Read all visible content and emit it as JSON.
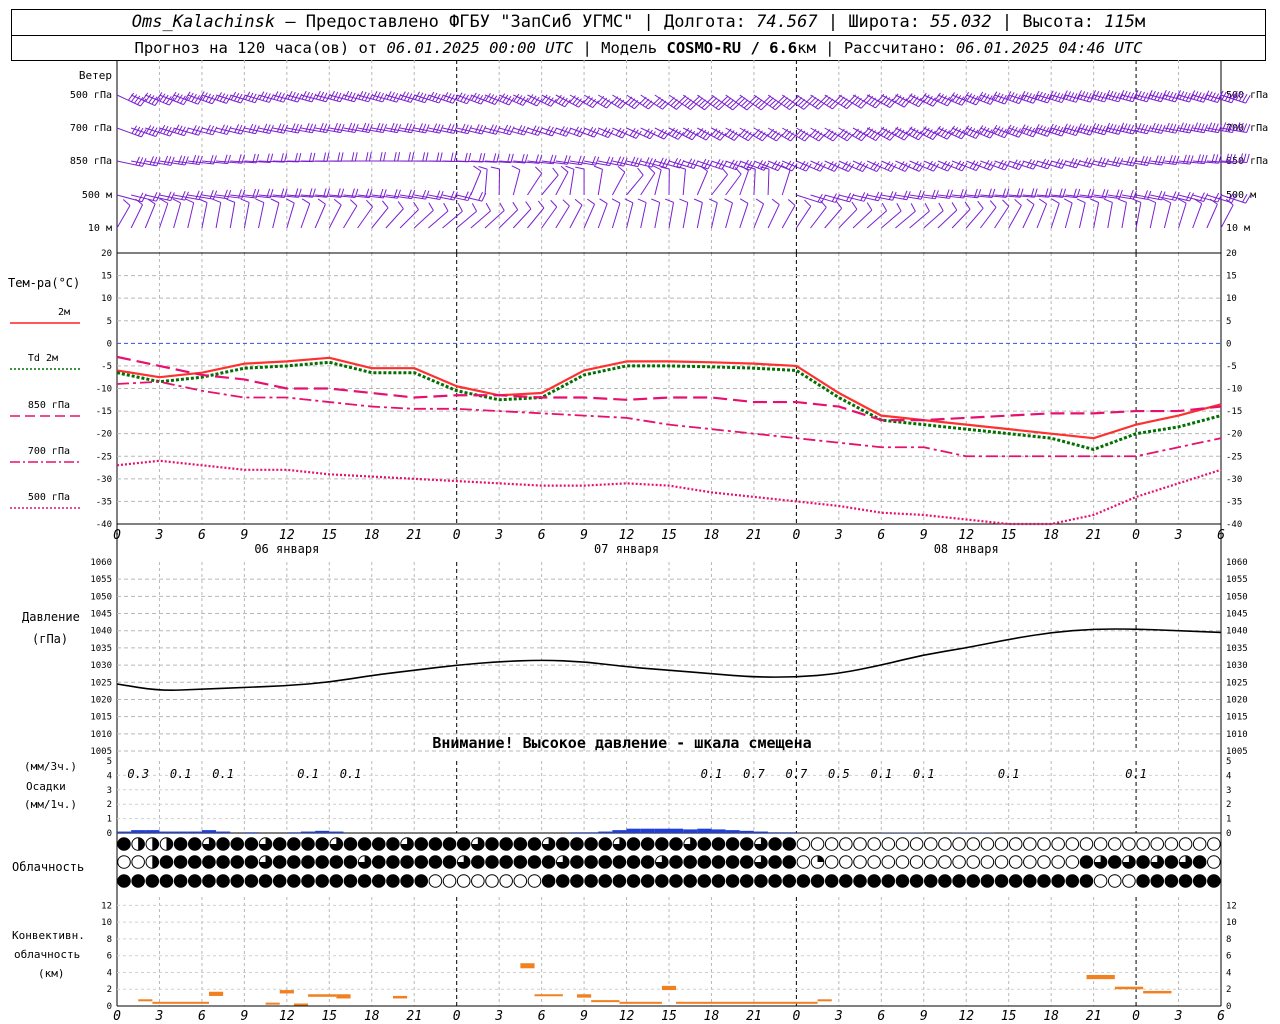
{
  "header": {
    "station": "Oms_Kalachinsk",
    "provider": "— Предоставлено ФГБУ \"ЗапСиб УГМС\" |",
    "lon_label": "Долгота:",
    "lon": "74.567",
    "lat_label": "| Широта:",
    "lat": "55.032",
    "alt_label": "| Высота:",
    "alt": "115",
    "alt_unit": "м",
    "forecast_label": "Прогноз на 120 часа(ов) от",
    "forecast_from": "06.01.2025 00:00 UTC",
    "model_label": "| Модель",
    "model": "COSMO-RU / 6.6",
    "model_unit": "км",
    "calc_label": "| Рассчитано:",
    "calc_time": "06.01.2025 04:46 UTC"
  },
  "wind": {
    "title": "Ветер",
    "levels": [
      "500 гПа",
      "700 гПа",
      "850 гПа",
      "500 м",
      "10 м"
    ],
    "color": "#7b1fd0"
  },
  "temp_panel": {
    "title": "Тем-ра(°С)",
    "legend": [
      {
        "label": "2м",
        "color": "#ff2020",
        "dash": "solid"
      },
      {
        "label": "Td 2м",
        "color": "#007000",
        "dash": "dot"
      },
      {
        "label": "850 гПа",
        "color": "#e8106e",
        "dash": "dash"
      },
      {
        "label": "700 гПа",
        "color": "#e8106e",
        "dash": "dashdot"
      },
      {
        "label": "500 гПа",
        "color": "#e8106e",
        "dash": "dot"
      }
    ]
  },
  "pressure_panel": {
    "title": "Давление",
    "unit": "(гПа)",
    "warning": "Внимание! Высокое давление - шкала смещена"
  },
  "precip_panel": {
    "unit_top": "(мм/3ч.)",
    "title": "Осадки",
    "unit_bottom": "(мм/1ч.)",
    "labels": [
      {
        "h": 3,
        "t": "0.3"
      },
      {
        "h": 9,
        "t": "0.1"
      },
      {
        "h": 15,
        "t": "0.1"
      },
      {
        "h": 27,
        "t": "0.1"
      },
      {
        "h": 33,
        "t": "0.1"
      },
      {
        "h": 84,
        "t": "0.1"
      },
      {
        "h": 90,
        "t": "0.7"
      },
      {
        "h": 96,
        "t": "0.7"
      },
      {
        "h": 102,
        "t": "0.5"
      },
      {
        "h": 108,
        "t": "0.1"
      },
      {
        "h": 114,
        "t": "0.1"
      },
      {
        "h": 126,
        "t": "0.1"
      },
      {
        "h": 144,
        "t": "0.1"
      }
    ],
    "color": "#1f3fd8"
  },
  "cloud_panel": {
    "title": "Облачность"
  },
  "conv_panel": {
    "title1": "Конвективн.",
    "title2": "облачность",
    "unit": "(км)",
    "color": "#f08020"
  },
  "time_axis": {
    "tick_labels": [
      "0",
      "3",
      "6",
      "9",
      "12",
      "15",
      "18",
      "21",
      "0",
      "3",
      "6",
      "9",
      "12",
      "15",
      "18",
      "21",
      "0",
      "3",
      "6",
      "9",
      "12",
      "15",
      "18",
      "21",
      "0",
      "3",
      "6"
    ],
    "days": [
      {
        "h": 12,
        "t": "06 января"
      },
      {
        "h": 36,
        "t": "07 января"
      },
      {
        "h": 60,
        "t": "08 января"
      }
    ]
  },
  "chart_data": [
    {
      "type": "line",
      "title": "",
      "xlabel": "",
      "ylabel": "Тем-ра(°С)",
      "ylim": [
        -40,
        20
      ],
      "x_hours": [
        0,
        3,
        6,
        9,
        12,
        15,
        18,
        21,
        24,
        27,
        30,
        33,
        36,
        39,
        42,
        45,
        48,
        51,
        54,
        57,
        60,
        63,
        66,
        69,
        72,
        75,
        78
      ],
      "series": [
        {
          "name": "2м",
          "values": [
            -6,
            -7.5,
            -6.5,
            -4.5,
            -4,
            -3.2,
            -5.5,
            -5.5,
            -9.5,
            -11.5,
            -11,
            -6,
            -4,
            -4,
            -4.2,
            -4.5,
            -5,
            -11,
            -16,
            -17,
            -18,
            -19,
            -20,
            -21,
            -18,
            -16,
            -13.5
          ]
        },
        {
          "name": "Td 2м",
          "values": [
            -6.5,
            -8.5,
            -7.5,
            -5.5,
            -5,
            -4.2,
            -6.5,
            -6.5,
            -10.5,
            -12.5,
            -12,
            -7,
            -5,
            -5,
            -5.2,
            -5.5,
            -6,
            -12,
            -17,
            -18,
            -19,
            -20,
            -21,
            -23.5,
            -20,
            -18.5,
            -16
          ]
        },
        {
          "name": "850 гПа",
          "values": [
            -3,
            -5,
            -7,
            -8,
            -10,
            -10,
            -11,
            -12,
            -11.5,
            -11.5,
            -12,
            -12,
            -12.5,
            -12,
            -12,
            -13,
            -13,
            -14,
            -17,
            -17,
            -16.5,
            -16,
            -15.5,
            -15.5,
            -15,
            -15,
            -14
          ]
        },
        {
          "name": "700 гПа",
          "values": [
            -9,
            -8.5,
            -10.5,
            -12,
            -12,
            -13,
            -14,
            -14.5,
            -14.5,
            -15,
            -15.5,
            -16,
            -16.5,
            -18,
            -19,
            -20,
            -21,
            -22,
            -23,
            -23,
            -25,
            -25,
            -25,
            -25,
            -25,
            -23,
            -21
          ]
        },
        {
          "name": "500 гПа",
          "values": [
            -27,
            -26,
            -27,
            -28,
            -28,
            -29,
            -29.5,
            -30,
            -30.5,
            -31,
            -31.5,
            -31.5,
            -31,
            -31.5,
            -33,
            -34,
            -35,
            -36,
            -37.5,
            -38,
            -39,
            -41,
            -43,
            -38,
            -34,
            -31,
            -28
          ]
        }
      ]
    },
    {
      "type": "line",
      "title": "",
      "xlabel": "",
      "ylabel": "Давление (гПа)",
      "ylim": [
        1005,
        1060
      ],
      "x_hours": [
        0,
        3,
        6,
        9,
        12,
        15,
        18,
        21,
        24,
        27,
        30,
        33,
        36,
        39,
        42,
        45,
        48,
        51,
        54,
        57,
        60,
        63,
        66,
        69,
        72,
        75,
        78
      ],
      "series": [
        {
          "name": "",
          "values": [
            1024.5,
            1022.5,
            1023,
            1023.5,
            1024,
            1025,
            1027,
            1028.5,
            1030,
            1031,
            1031.5,
            1031,
            1029.5,
            1028.5,
            1027.5,
            1026.5,
            1026.5,
            1027.5,
            1030,
            1033,
            1035,
            1037.5,
            1039.5,
            1040.5,
            1040.5,
            1040,
            1039.5
          ]
        }
      ]
    },
    {
      "type": "bar",
      "title": "",
      "xlabel": "",
      "ylabel": "Осадки (мм/1ч.)",
      "ylim": [
        0,
        5
      ],
      "x_hours": [
        0,
        1,
        2,
        3,
        4,
        5,
        6,
        7,
        8,
        9,
        10,
        11,
        12,
        13,
        14,
        15,
        16,
        17,
        18,
        19,
        20,
        21,
        22,
        23,
        24,
        25,
        26,
        27,
        28,
        29,
        30,
        31,
        32,
        33,
        34,
        35,
        36,
        37,
        38,
        39,
        40,
        41,
        42,
        43,
        44,
        45,
        46,
        47,
        48,
        49,
        50,
        51,
        52,
        53,
        54,
        55,
        56,
        57,
        58,
        59,
        60,
        61,
        62,
        63,
        64,
        65,
        66,
        67,
        68,
        69,
        70,
        71,
        72,
        73,
        74,
        75,
        76,
        77
      ],
      "values": [
        0.1,
        0.2,
        0.2,
        0.1,
        0.1,
        0.1,
        0.2,
        0.1,
        0,
        0.05,
        0,
        0,
        0.05,
        0.1,
        0.15,
        0.1,
        0,
        0,
        0,
        0,
        0,
        0,
        0,
        0,
        0,
        0,
        0,
        0,
        0,
        0,
        0,
        0,
        0.05,
        0.05,
        0.1,
        0.2,
        0.3,
        0.3,
        0.3,
        0.3,
        0.25,
        0.3,
        0.25,
        0.2,
        0.15,
        0.1,
        0.05,
        0.05,
        0,
        0,
        0,
        0,
        0,
        0,
        0.02,
        0.02,
        0.02,
        0,
        0,
        0.02,
        0.02,
        0.02,
        0,
        0,
        0,
        0,
        0,
        0,
        0,
        0,
        0,
        0,
        0,
        0,
        0,
        0,
        0,
        0
      ]
    },
    {
      "type": "bar",
      "title": "",
      "xlabel": "",
      "ylabel": "Конвективн. облачность (км)",
      "ylim": [
        0,
        13
      ],
      "segments": [
        {
          "from": 1.5,
          "to": 2.5,
          "base": 0.6,
          "top": 0.8
        },
        {
          "from": 2.5,
          "to": 6.5,
          "base": 0.3,
          "top": 0.5
        },
        {
          "from": 6.5,
          "to": 7.5,
          "base": 1.2,
          "top": 1.7
        },
        {
          "from": 10.5,
          "to": 11.5,
          "base": 0.2,
          "top": 0.4
        },
        {
          "from": 11.5,
          "to": 12.5,
          "base": 1.5,
          "top": 1.9
        },
        {
          "from": 12.5,
          "to": 13.5,
          "base": 0.1,
          "top": 0.3
        },
        {
          "from": 13.5,
          "to": 15.5,
          "base": 1.1,
          "top": 1.4
        },
        {
          "from": 15.5,
          "to": 16.5,
          "base": 0.9,
          "top": 1.4
        },
        {
          "from": 19.5,
          "to": 20.5,
          "base": 0.9,
          "top": 1.2
        },
        {
          "from": 28.5,
          "to": 29.5,
          "base": 4.5,
          "top": 5.1
        },
        {
          "from": 29.5,
          "to": 31.5,
          "base": 1.2,
          "top": 1.4
        },
        {
          "from": 32.5,
          "to": 33.5,
          "base": 1.0,
          "top": 1.4
        },
        {
          "from": 33.5,
          "to": 35.5,
          "base": 0.5,
          "top": 0.7
        },
        {
          "from": 35.5,
          "to": 38.5,
          "base": 0.3,
          "top": 0.5
        },
        {
          "from": 38.5,
          "to": 39.5,
          "base": 1.9,
          "top": 2.4
        },
        {
          "from": 39.5,
          "to": 49.5,
          "base": 0.3,
          "top": 0.5
        },
        {
          "from": 49.5,
          "to": 50.5,
          "base": 0.6,
          "top": 0.8
        },
        {
          "from": 68.5,
          "to": 70.5,
          "base": 3.2,
          "top": 3.7
        },
        {
          "from": 70.5,
          "to": 72.5,
          "base": 2.0,
          "top": 2.3
        },
        {
          "from": 72.5,
          "to": 74.5,
          "base": 1.5,
          "top": 1.8
        }
      ]
    }
  ]
}
